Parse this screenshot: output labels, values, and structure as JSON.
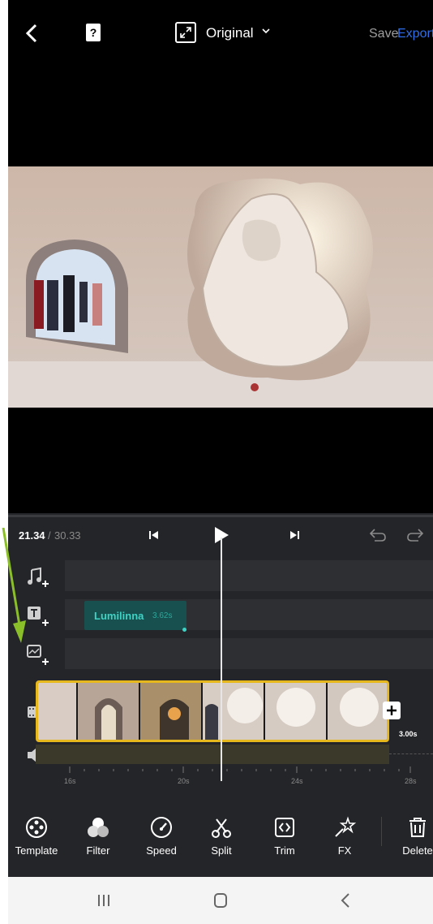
{
  "topbar": {
    "back_icon": "chevron-left-icon",
    "help_label": "?",
    "aspect_label": "Original",
    "save_label": "Save",
    "export_label": "Export",
    "export_color": "#2e6ee8"
  },
  "timeline": {
    "current_time": "21.34",
    "separator": "/",
    "total_time": "30.33",
    "text_clip": {
      "title": "Lumilinna",
      "duration": "3.62s"
    },
    "transition_duration": "3.00s",
    "ruler_ticks": [
      "16s",
      "20s",
      "24s",
      "28s"
    ]
  },
  "toolbar": {
    "tools": [
      {
        "label": "Template",
        "icon": "template-icon"
      },
      {
        "label": "Filter",
        "icon": "filter-icon"
      },
      {
        "label": "Speed",
        "icon": "speed-icon"
      },
      {
        "label": "Split",
        "icon": "scissors-icon"
      },
      {
        "label": "Trim",
        "icon": "trim-icon"
      },
      {
        "label": "FX",
        "icon": "fx-icon"
      },
      {
        "label": "Delete",
        "icon": "trash-icon"
      }
    ]
  },
  "colors": {
    "accent": "#e6b81e",
    "text_clip": "#17504e",
    "text_clip_label": "#3fd3c6"
  }
}
